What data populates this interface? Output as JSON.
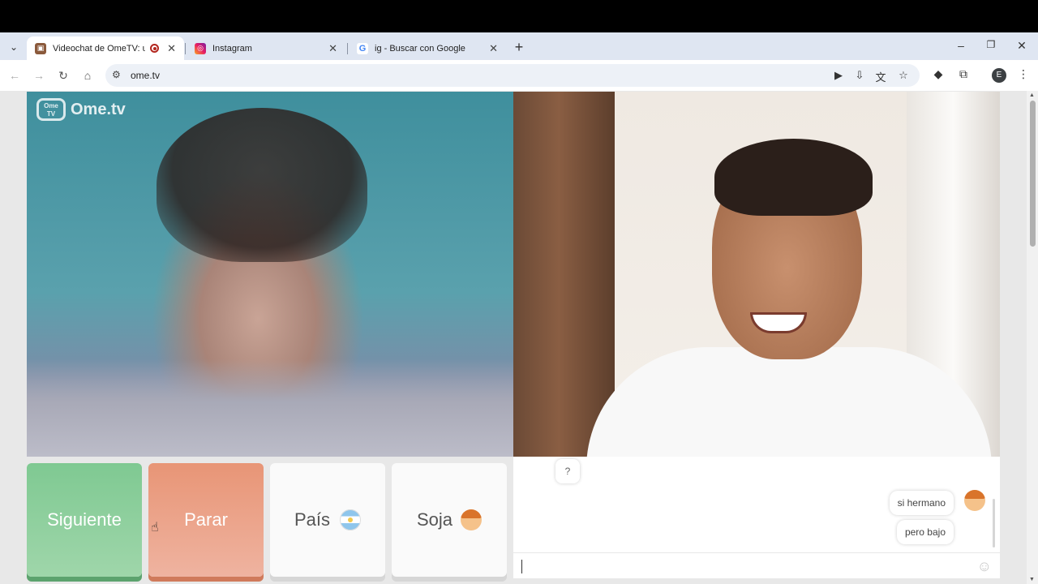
{
  "browser": {
    "tabs": [
      {
        "title": "Videochat de OmeTV: una",
        "active": true,
        "recording": true,
        "favicon": "ometv-favicon"
      },
      {
        "title": "Instagram",
        "active": false,
        "favicon": "instagram-favicon"
      },
      {
        "title": "ig - Buscar con Google",
        "active": false,
        "favicon": "google-favicon"
      }
    ],
    "url": "ome.tv",
    "profile_initial": "E"
  },
  "video": {
    "logo_badge": "Ome TV",
    "logo_text": "Ome.tv"
  },
  "controls": {
    "next_label": "Siguiente",
    "stop_label": "Parar",
    "country_label": "País",
    "gender_label": "Soja"
  },
  "chat": {
    "help_label": "?",
    "messages": [
      {
        "text": "si hermano"
      },
      {
        "text": "pero bajo"
      }
    ]
  },
  "colors": {
    "next_button": "#7fc992",
    "stop_button": "#e89576",
    "tab_strip": "#dfe6f2"
  }
}
